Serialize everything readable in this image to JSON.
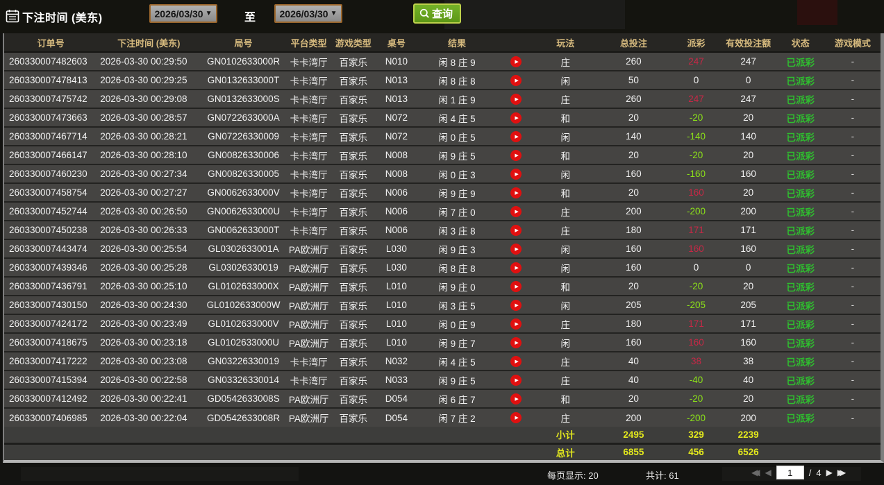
{
  "filter_bar": {
    "label": "下注时间 (美东)",
    "date_from": "2026/03/30",
    "to_label": "至",
    "date_to": "2026/03/30",
    "search_label": "查询"
  },
  "table": {
    "headers": [
      "订单号",
      "下注时间 (美东)",
      "局号",
      "平台类型",
      "游戏类型",
      "桌号",
      "结果",
      "玩法",
      "总投注",
      "派彩",
      "有效投注额",
      "状态",
      "游戏模式"
    ],
    "rows": [
      {
        "order": "260330007482603",
        "time": "2026-03-30 00:29:50",
        "round": "GN0102633000R",
        "platform": "卡卡湾厅",
        "game": "百家乐",
        "table": "N010",
        "result": "闲 8 庄 9",
        "wager": "庄",
        "total": "260",
        "payout": "247",
        "payout_class": "pos",
        "valid": "247",
        "status": "已派彩",
        "mode": "-"
      },
      {
        "order": "260330007478413",
        "time": "2026-03-30 00:29:25",
        "round": "GN0132633000T",
        "platform": "卡卡湾厅",
        "game": "百家乐",
        "table": "N013",
        "result": "闲 8 庄 8",
        "wager": "闲",
        "total": "50",
        "payout": "0",
        "payout_class": "zero",
        "valid": "0",
        "status": "已派彩",
        "mode": "-"
      },
      {
        "order": "260330007475742",
        "time": "2026-03-30 00:29:08",
        "round": "GN0132633000S",
        "platform": "卡卡湾厅",
        "game": "百家乐",
        "table": "N013",
        "result": "闲 1 庄 9",
        "wager": "庄",
        "total": "260",
        "payout": "247",
        "payout_class": "pos",
        "valid": "247",
        "status": "已派彩",
        "mode": "-"
      },
      {
        "order": "260330007473663",
        "time": "2026-03-30 00:28:57",
        "round": "GN0722633000A",
        "platform": "卡卡湾厅",
        "game": "百家乐",
        "table": "N072",
        "result": "闲 4 庄 5",
        "wager": "和",
        "total": "20",
        "payout": "-20",
        "payout_class": "neg",
        "valid": "20",
        "status": "已派彩",
        "mode": "-"
      },
      {
        "order": "260330007467714",
        "time": "2026-03-30 00:28:21",
        "round": "GN07226330009",
        "platform": "卡卡湾厅",
        "game": "百家乐",
        "table": "N072",
        "result": "闲 0 庄 5",
        "wager": "闲",
        "total": "140",
        "payout": "-140",
        "payout_class": "neg",
        "valid": "140",
        "status": "已派彩",
        "mode": "-"
      },
      {
        "order": "260330007466147",
        "time": "2026-03-30 00:28:10",
        "round": "GN00826330006",
        "platform": "卡卡湾厅",
        "game": "百家乐",
        "table": "N008",
        "result": "闲 9 庄 5",
        "wager": "和",
        "total": "20",
        "payout": "-20",
        "payout_class": "neg",
        "valid": "20",
        "status": "已派彩",
        "mode": "-"
      },
      {
        "order": "260330007460230",
        "time": "2026-03-30 00:27:34",
        "round": "GN00826330005",
        "platform": "卡卡湾厅",
        "game": "百家乐",
        "table": "N008",
        "result": "闲 0 庄 3",
        "wager": "闲",
        "total": "160",
        "payout": "-160",
        "payout_class": "neg",
        "valid": "160",
        "status": "已派彩",
        "mode": "-"
      },
      {
        "order": "260330007458754",
        "time": "2026-03-30 00:27:27",
        "round": "GN0062633000V",
        "platform": "卡卡湾厅",
        "game": "百家乐",
        "table": "N006",
        "result": "闲 9 庄 9",
        "wager": "和",
        "total": "20",
        "payout": "160",
        "payout_class": "pos",
        "valid": "20",
        "status": "已派彩",
        "mode": "-"
      },
      {
        "order": "260330007452744",
        "time": "2026-03-30 00:26:50",
        "round": "GN0062633000U",
        "platform": "卡卡湾厅",
        "game": "百家乐",
        "table": "N006",
        "result": "闲 7 庄 0",
        "wager": "庄",
        "total": "200",
        "payout": "-200",
        "payout_class": "neg",
        "valid": "200",
        "status": "已派彩",
        "mode": "-"
      },
      {
        "order": "260330007450238",
        "time": "2026-03-30 00:26:33",
        "round": "GN0062633000T",
        "platform": "卡卡湾厅",
        "game": "百家乐",
        "table": "N006",
        "result": "闲 3 庄 8",
        "wager": "庄",
        "total": "180",
        "payout": "171",
        "payout_class": "pos",
        "valid": "171",
        "status": "已派彩",
        "mode": "-"
      },
      {
        "order": "260330007443474",
        "time": "2026-03-30 00:25:54",
        "round": "GL0302633001A",
        "platform": "PA欧洲厅",
        "game": "百家乐",
        "table": "L030",
        "result": "闲 9 庄 3",
        "wager": "闲",
        "total": "160",
        "payout": "160",
        "payout_class": "pos",
        "valid": "160",
        "status": "已派彩",
        "mode": "-"
      },
      {
        "order": "260330007439346",
        "time": "2026-03-30 00:25:28",
        "round": "GL03026330019",
        "platform": "PA欧洲厅",
        "game": "百家乐",
        "table": "L030",
        "result": "闲 8 庄 8",
        "wager": "闲",
        "total": "160",
        "payout": "0",
        "payout_class": "zero",
        "valid": "0",
        "status": "已派彩",
        "mode": "-"
      },
      {
        "order": "260330007436791",
        "time": "2026-03-30 00:25:10",
        "round": "GL0102633000X",
        "platform": "PA欧洲厅",
        "game": "百家乐",
        "table": "L010",
        "result": "闲 9 庄 0",
        "wager": "和",
        "total": "20",
        "payout": "-20",
        "payout_class": "neg",
        "valid": "20",
        "status": "已派彩",
        "mode": "-"
      },
      {
        "order": "260330007430150",
        "time": "2026-03-30 00:24:30",
        "round": "GL0102633000W",
        "platform": "PA欧洲厅",
        "game": "百家乐",
        "table": "L010",
        "result": "闲 3 庄 5",
        "wager": "闲",
        "total": "205",
        "payout": "-205",
        "payout_class": "neg",
        "valid": "205",
        "status": "已派彩",
        "mode": "-"
      },
      {
        "order": "260330007424172",
        "time": "2026-03-30 00:23:49",
        "round": "GL0102633000V",
        "platform": "PA欧洲厅",
        "game": "百家乐",
        "table": "L010",
        "result": "闲 0 庄 9",
        "wager": "庄",
        "total": "180",
        "payout": "171",
        "payout_class": "pos",
        "valid": "171",
        "status": "已派彩",
        "mode": "-"
      },
      {
        "order": "260330007418675",
        "time": "2026-03-30 00:23:18",
        "round": "GL0102633000U",
        "platform": "PA欧洲厅",
        "game": "百家乐",
        "table": "L010",
        "result": "闲 9 庄 7",
        "wager": "闲",
        "total": "160",
        "payout": "160",
        "payout_class": "pos",
        "valid": "160",
        "status": "已派彩",
        "mode": "-"
      },
      {
        "order": "260330007417222",
        "time": "2026-03-30 00:23:08",
        "round": "GN03226330019",
        "platform": "卡卡湾厅",
        "game": "百家乐",
        "table": "N032",
        "result": "闲 4 庄 5",
        "wager": "庄",
        "total": "40",
        "payout": "38",
        "payout_class": "pos",
        "valid": "38",
        "status": "已派彩",
        "mode": "-"
      },
      {
        "order": "260330007415394",
        "time": "2026-03-30 00:22:58",
        "round": "GN03326330014",
        "platform": "卡卡湾厅",
        "game": "百家乐",
        "table": "N033",
        "result": "闲 9 庄 5",
        "wager": "庄",
        "total": "40",
        "payout": "-40",
        "payout_class": "neg",
        "valid": "40",
        "status": "已派彩",
        "mode": "-"
      },
      {
        "order": "260330007412492",
        "time": "2026-03-30 00:22:41",
        "round": "GD0542633008S",
        "platform": "PA欧洲厅",
        "game": "百家乐",
        "table": "D054",
        "result": "闲 6 庄 7",
        "wager": "和",
        "total": "20",
        "payout": "-20",
        "payout_class": "neg",
        "valid": "20",
        "status": "已派彩",
        "mode": "-"
      },
      {
        "order": "260330007406985",
        "time": "2026-03-30 00:22:04",
        "round": "GD0542633008R",
        "platform": "PA欧洲厅",
        "game": "百家乐",
        "table": "D054",
        "result": "闲 7 庄 2",
        "wager": "庄",
        "total": "200",
        "payout": "-200",
        "payout_class": "neg",
        "valid": "200",
        "status": "已派彩",
        "mode": "-"
      }
    ],
    "subtotal": {
      "label": "小计",
      "total": "2495",
      "payout": "329",
      "valid": "2239"
    },
    "grand_total": {
      "label": "总计",
      "total": "6855",
      "payout": "456",
      "valid": "6526"
    }
  },
  "footer": {
    "per_page": "每页显示: 20",
    "total_count": "共计: 61",
    "current_page": "1",
    "page_separator": "/",
    "total_pages": "4"
  },
  "colors": {
    "accent_green_button": "#67a41f",
    "payout_positive": "#c62846",
    "payout_negative": "#8ce219",
    "status_green": "#2fbe2f",
    "totals_yellow": "#e3e81d",
    "header_text_gold": "#d6ba7e"
  }
}
